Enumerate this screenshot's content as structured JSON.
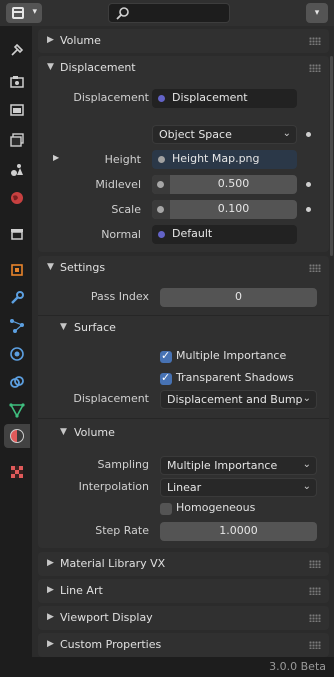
{
  "header": {
    "editor_icon": "properties-editor-icon",
    "search_icon": "search-icon",
    "search_value": "",
    "options_icon": "chevron-down-icon"
  },
  "tabs": [
    {
      "icon": "tool-icon",
      "active": false
    },
    {
      "icon": "render-icon",
      "active": false
    },
    {
      "icon": "output-icon",
      "active": false
    },
    {
      "icon": "view-layer-icon",
      "active": false
    },
    {
      "icon": "scene-icon",
      "active": false
    },
    {
      "icon": "world-icon",
      "active": false
    },
    {
      "icon": "collection-icon",
      "active": false
    },
    {
      "icon": "object-icon",
      "active": false
    },
    {
      "icon": "modifier-icon",
      "active": false
    },
    {
      "icon": "particles-icon",
      "active": false
    },
    {
      "icon": "physics-icon",
      "active": false
    },
    {
      "icon": "constraints-icon",
      "active": false
    },
    {
      "icon": "object-data-icon",
      "active": false
    },
    {
      "icon": "material-icon",
      "active": true
    },
    {
      "icon": "texture-icon",
      "active": false
    }
  ],
  "sections": {
    "volume_top": {
      "title": "Volume"
    },
    "displacement": {
      "title": "Displacement",
      "displacement_label": "Displacement",
      "displacement_value": "Displacement",
      "space_value": "Object Space",
      "height_label": "Height",
      "height_value": "Height Map.png",
      "midlevel_label": "Midlevel",
      "midlevel_value": "0.500",
      "scale_label": "Scale",
      "scale_value": "0.100",
      "normal_label": "Normal",
      "normal_value": "Default"
    },
    "settings": {
      "title": "Settings",
      "pass_index_label": "Pass Index",
      "pass_index_value": "0",
      "surface": {
        "title": "Surface",
        "multiple_importance_label": "Multiple Importance",
        "multiple_importance_checked": true,
        "transparent_shadows_label": "Transparent Shadows",
        "transparent_shadows_checked": true,
        "displacement_label": "Displacement",
        "displacement_value": "Displacement and Bump"
      },
      "volume": {
        "title": "Volume",
        "sampling_label": "Sampling",
        "sampling_value": "Multiple Importance",
        "interpolation_label": "Interpolation",
        "interpolation_value": "Linear",
        "homogeneous_label": "Homogeneous",
        "homogeneous_checked": false,
        "step_rate_label": "Step Rate",
        "step_rate_value": "1.0000"
      }
    },
    "material_library": {
      "title": "Material Library VX"
    },
    "line_art": {
      "title": "Line Art"
    },
    "viewport_display": {
      "title": "Viewport Display"
    },
    "custom_properties": {
      "title": "Custom Properties"
    }
  },
  "status": {
    "version": "3.0.0 Beta"
  },
  "colors": {
    "shader_socket": "#6363c7",
    "color_socket": "#c7c729",
    "gray_socket": "#a1a1a1",
    "checkbox_on": "#4772b3",
    "active_tab_material": "#e05a5a"
  }
}
